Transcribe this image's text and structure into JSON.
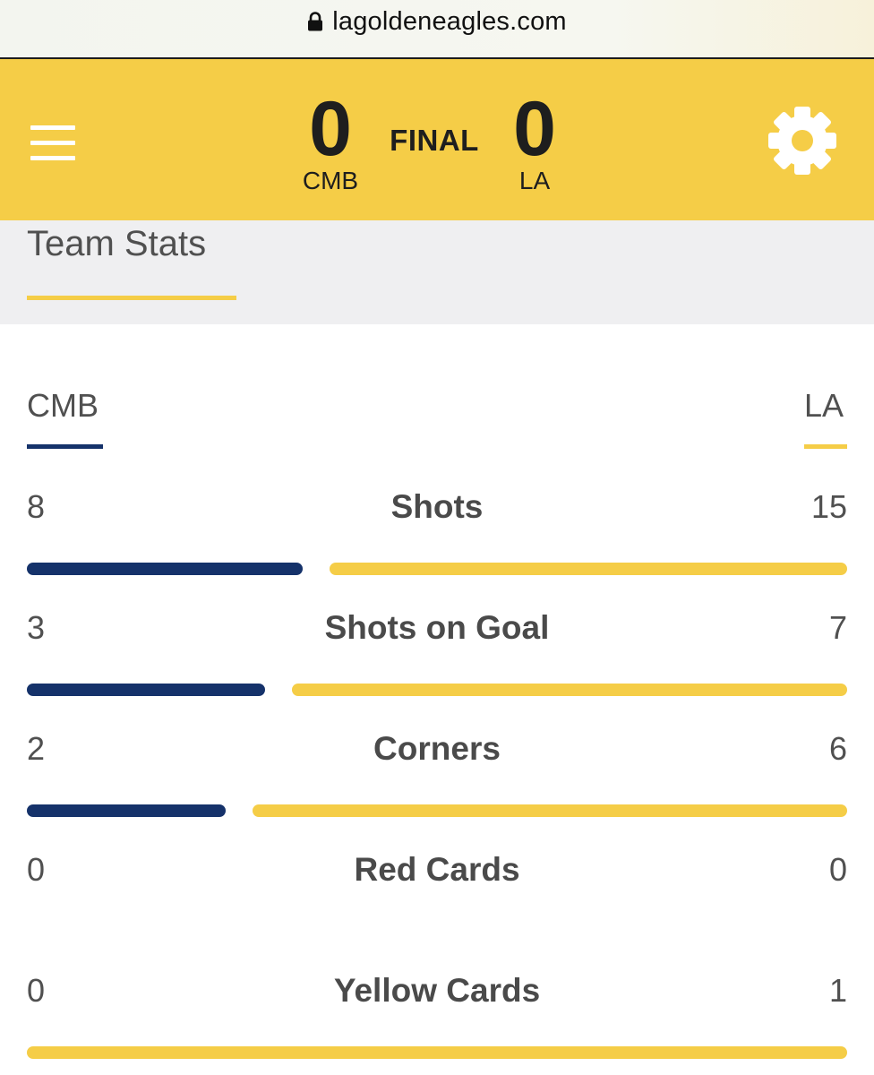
{
  "browser": {
    "url": "lagoldeneagles.com",
    "lock_icon": "lock-icon"
  },
  "colors": {
    "accent_yellow": "#f5cd47",
    "home_navy": "#15326a",
    "tab_background": "#efeff1"
  },
  "scoreboard": {
    "menu_icon": "hamburger-menu-icon",
    "settings_icon": "gear-icon",
    "left_team": {
      "abbr": "CMB",
      "score": "0"
    },
    "right_team": {
      "abbr": "LA",
      "score": "0"
    },
    "status": "FINAL"
  },
  "tabs": [
    {
      "label": "Team Stats",
      "active": true
    }
  ],
  "stats": {
    "left_team": "CMB",
    "right_team": "LA",
    "rows": [
      {
        "name": "Shots",
        "left": "8",
        "right": "15"
      },
      {
        "name": "Shots on Goal",
        "left": "3",
        "right": "7"
      },
      {
        "name": "Corners",
        "left": "2",
        "right": "6"
      },
      {
        "name": "Red Cards",
        "left": "0",
        "right": "0"
      },
      {
        "name": "Yellow Cards",
        "left": "0",
        "right": "1"
      }
    ]
  }
}
